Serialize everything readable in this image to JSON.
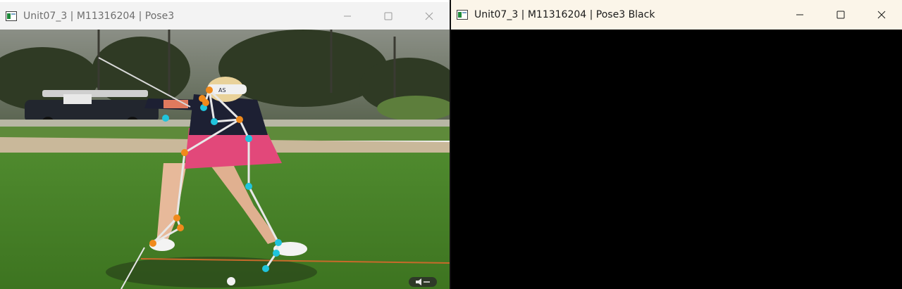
{
  "windows": {
    "left": {
      "title": "Unit07_3 | M11316204 | Pose3",
      "controls": [
        "minimize-icon",
        "maximize-icon",
        "close-icon"
      ],
      "content": "video frame with pose overlay"
    },
    "right": {
      "title": "Unit07_3 | M11316204 | Pose3 Black",
      "controls": [
        "minimize-icon",
        "maximize-icon",
        "close-icon"
      ],
      "content": "pose overlay on black background"
    }
  },
  "colors": {
    "left_side_keypoints": "#f08a1c",
    "right_side_keypoints": "#20c4dc",
    "skeleton_lines": "#e8e8e8",
    "black_canvas": "#000000"
  },
  "shirt_logo_text": "AS"
}
